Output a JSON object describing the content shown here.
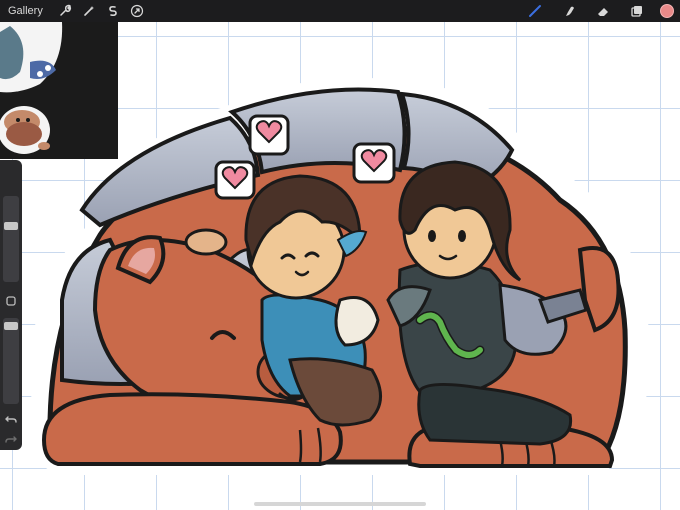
{
  "toolbar": {
    "gallery_label": "Gallery",
    "left_tools": [
      "wrench-icon",
      "magic-wand-icon",
      "selection-icon",
      "transform-icon"
    ],
    "right_tools": [
      "brush-icon",
      "smudge-icon",
      "eraser-icon",
      "layers-icon"
    ],
    "active_tool": "brush-icon",
    "active_color": "#e98a8a",
    "accent_color": "#3b6fe0"
  },
  "sidebar": {
    "buttons": [
      "modify-square-icon",
      "undo-icon",
      "redo-icon"
    ]
  },
  "colors": {
    "creature_fur": "#c96a4a",
    "armor_plate": "#a9afbf",
    "outline": "#1a1a1a",
    "heart_pink": "#f08aa0"
  }
}
